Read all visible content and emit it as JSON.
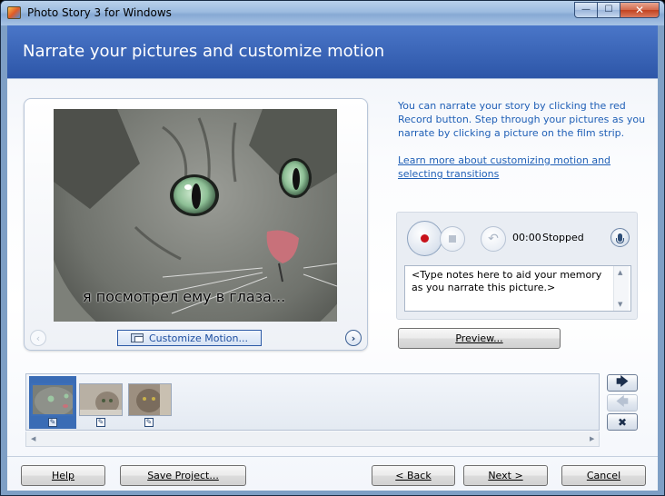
{
  "window": {
    "title": "Photo Story 3 for Windows",
    "minimize_glyph": "—",
    "maximize_glyph": "☐",
    "close_glyph": "✕"
  },
  "header": {
    "title": "Narrate your pictures and customize motion"
  },
  "preview": {
    "caption": "я посмотрел ему в глаза...",
    "customize_motion_label": "Customize Motion...",
    "prev_glyph": "‹",
    "next_glyph": "›",
    "image_subject": "cat close-up"
  },
  "info": {
    "text": "You can narrate your story by clicking the red Record button. Step through your pictures as you narrate by clicking a picture on the film strip.",
    "link": "Learn more about customizing motion and selecting transitions"
  },
  "recorder": {
    "time": "00:00",
    "status": "Stopped",
    "undo_glyph": "↶",
    "notes_text": "<Type notes here to aid your memory as you narrate this picture.>",
    "scroll_up_glyph": "▲",
    "scroll_down_glyph": "▼"
  },
  "buttons": {
    "preview": "Preview...",
    "help": "Help",
    "save_project": "Save Project...",
    "back": "< Back",
    "next": "Next >",
    "cancel": "Cancel"
  },
  "filmstrip": {
    "thumbnail_count": 3,
    "selected_index": 0,
    "move_right_glyph": "🡆",
    "move_left_glyph": "🡄",
    "delete_glyph": "✖",
    "edit_glyph": "✎",
    "scroll_left_glyph": "◀",
    "scroll_right_glyph": "▶"
  },
  "colors": {
    "header_bg": "#3a64b8",
    "link": "#1f5fb6",
    "record_red": "#c8121a"
  }
}
